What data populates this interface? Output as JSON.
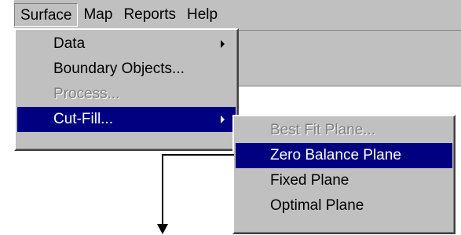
{
  "menubar": {
    "items": [
      {
        "label": "Surface",
        "open": true
      },
      {
        "label": "Map"
      },
      {
        "label": "Reports"
      },
      {
        "label": "Help"
      }
    ]
  },
  "surface_menu": {
    "items": [
      {
        "label": "Data",
        "submenu": true,
        "enabled": true
      },
      {
        "label": "Boundary Objects...",
        "submenu": false,
        "enabled": true
      },
      {
        "label": "Process...",
        "submenu": false,
        "enabled": false
      },
      {
        "label": "Cut-Fill...",
        "submenu": true,
        "enabled": true,
        "highlighted": true
      }
    ]
  },
  "cutfill_menu": {
    "items": [
      {
        "label": "Best Fit Plane...",
        "enabled": false
      },
      {
        "label": "Zero Balance Plane",
        "enabled": true,
        "highlighted": true
      },
      {
        "label": "Fixed Plane",
        "enabled": true
      },
      {
        "label": "Optimal Plane",
        "enabled": true
      }
    ]
  },
  "colors": {
    "menu_face": "#c0c0c0",
    "highlight": "#000080",
    "disabled_text": "#808080"
  }
}
